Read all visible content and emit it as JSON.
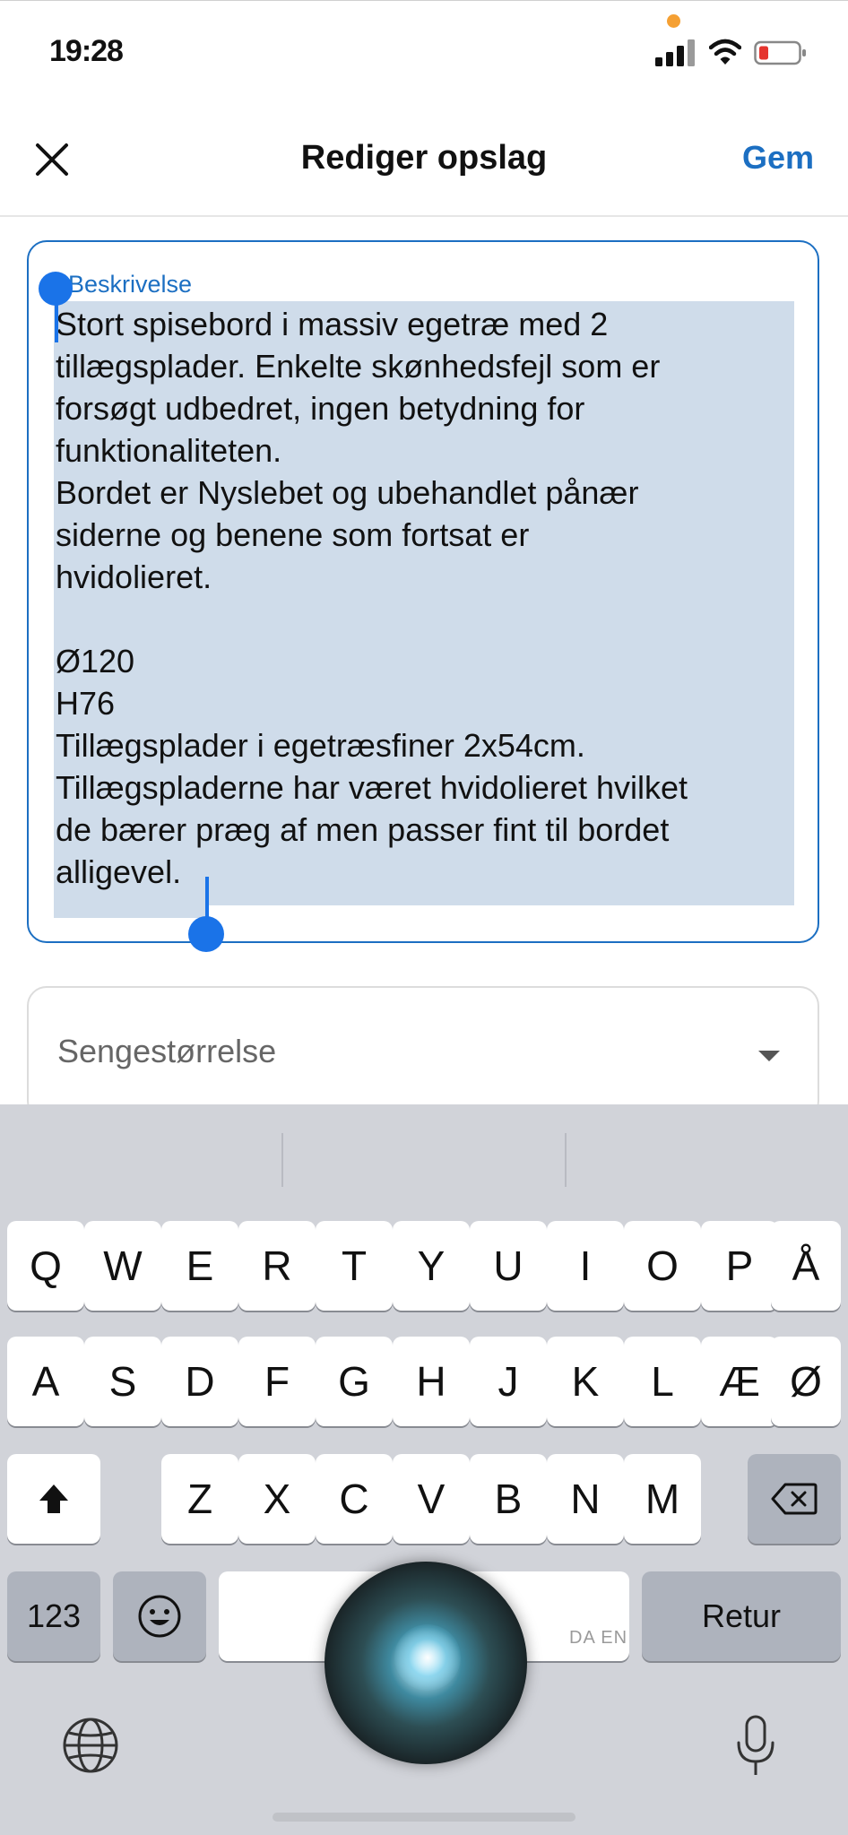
{
  "status_bar": {
    "time": "19:28"
  },
  "nav": {
    "title": "Rediger opslag",
    "save_label": "Gem"
  },
  "description": {
    "label": "Beskrivelse",
    "text": "Stort spisebord i massiv egetræ med 2\ntillægsplader. Enkelte skønhedsfejl som er\nforsøgt udbedret, ingen betydning for\nfunktionaliteten.\nBordet er Nyslebet og ubehandlet pånær\nsiderne og benene som fortsat er\nhvidolieret.\n\nØ120\nH76\nTillægsplader i egetræsfiner 2x54cm.\nTillægspladerne har været hvidolieret hvilket\nde bærer præg af men passer fint til bordet\nalligevel.",
    "selection_color": "#cfdcea",
    "accent_color": "#1c6fc2"
  },
  "size_select": {
    "placeholder": "Sengestørrelse"
  },
  "keyboard": {
    "row1": [
      "Q",
      "W",
      "E",
      "R",
      "T",
      "Y",
      "U",
      "I",
      "O",
      "P",
      "Å"
    ],
    "row2": [
      "A",
      "S",
      "D",
      "F",
      "G",
      "H",
      "J",
      "K",
      "L",
      "Æ",
      "Ø"
    ],
    "row3": [
      "Z",
      "X",
      "C",
      "V",
      "B",
      "N",
      "M"
    ],
    "numbers_label": "123",
    "return_label": "Retur",
    "language_hint": "DA EN",
    "icons": {
      "shift": "shift-icon",
      "backspace": "backspace-icon",
      "emoji": "emoji-icon",
      "globe": "globe-icon",
      "mic": "microphone-icon"
    }
  }
}
